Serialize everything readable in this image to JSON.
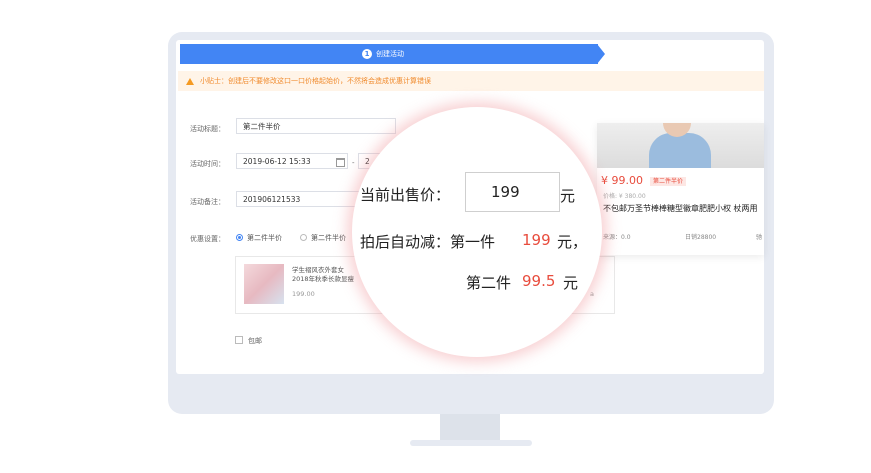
{
  "steps": {
    "number": "1",
    "label": "创建活动"
  },
  "notice": {
    "text": "小贴士：创建后不要修改这口一口价格起始价，不然将会造成优惠计算错误"
  },
  "form": {
    "title_label": "活动标题：",
    "title_value": "第二件半价",
    "time_label": "活动时间：",
    "time_start": "2019-06-12 15:33",
    "time_sep": "-",
    "time_end": "2",
    "remark_label": "活动备注：",
    "remark_value": "201906121533",
    "discount_label": "优惠设置：",
    "discount_options": [
      "第二件半价",
      "第二件半价"
    ],
    "product_name_line1": "学生褶风衣外套女",
    "product_name_line2": "2018年秋季长款显瘦",
    "product_price": "199.00",
    "product_extra": "a",
    "free_shipping_label": "包邮"
  },
  "card": {
    "price": "¥ 99.00",
    "price_tag": "第二件半价",
    "original_price": "价格: ¥ 380.00",
    "title": "不包邮万圣节棒棒糖型徽章肥肥小权 杖两用",
    "meta_left": "来源：0.0",
    "meta_mid": "日销28800",
    "meta_right": "驰"
  },
  "magnifier": {
    "current_price_label": "当前出售价：",
    "current_price_value": "199",
    "unit": "元",
    "auto_reduce_label": "拍后自动减：第一件",
    "first_value": "199",
    "first_suffix": "元，",
    "second_label": "第二件",
    "second_value": "99.5",
    "second_suffix": "元"
  },
  "colors": {
    "accent": "#4285f4",
    "price_red": "#e84c3d",
    "notice_orange": "#f08a2c"
  }
}
